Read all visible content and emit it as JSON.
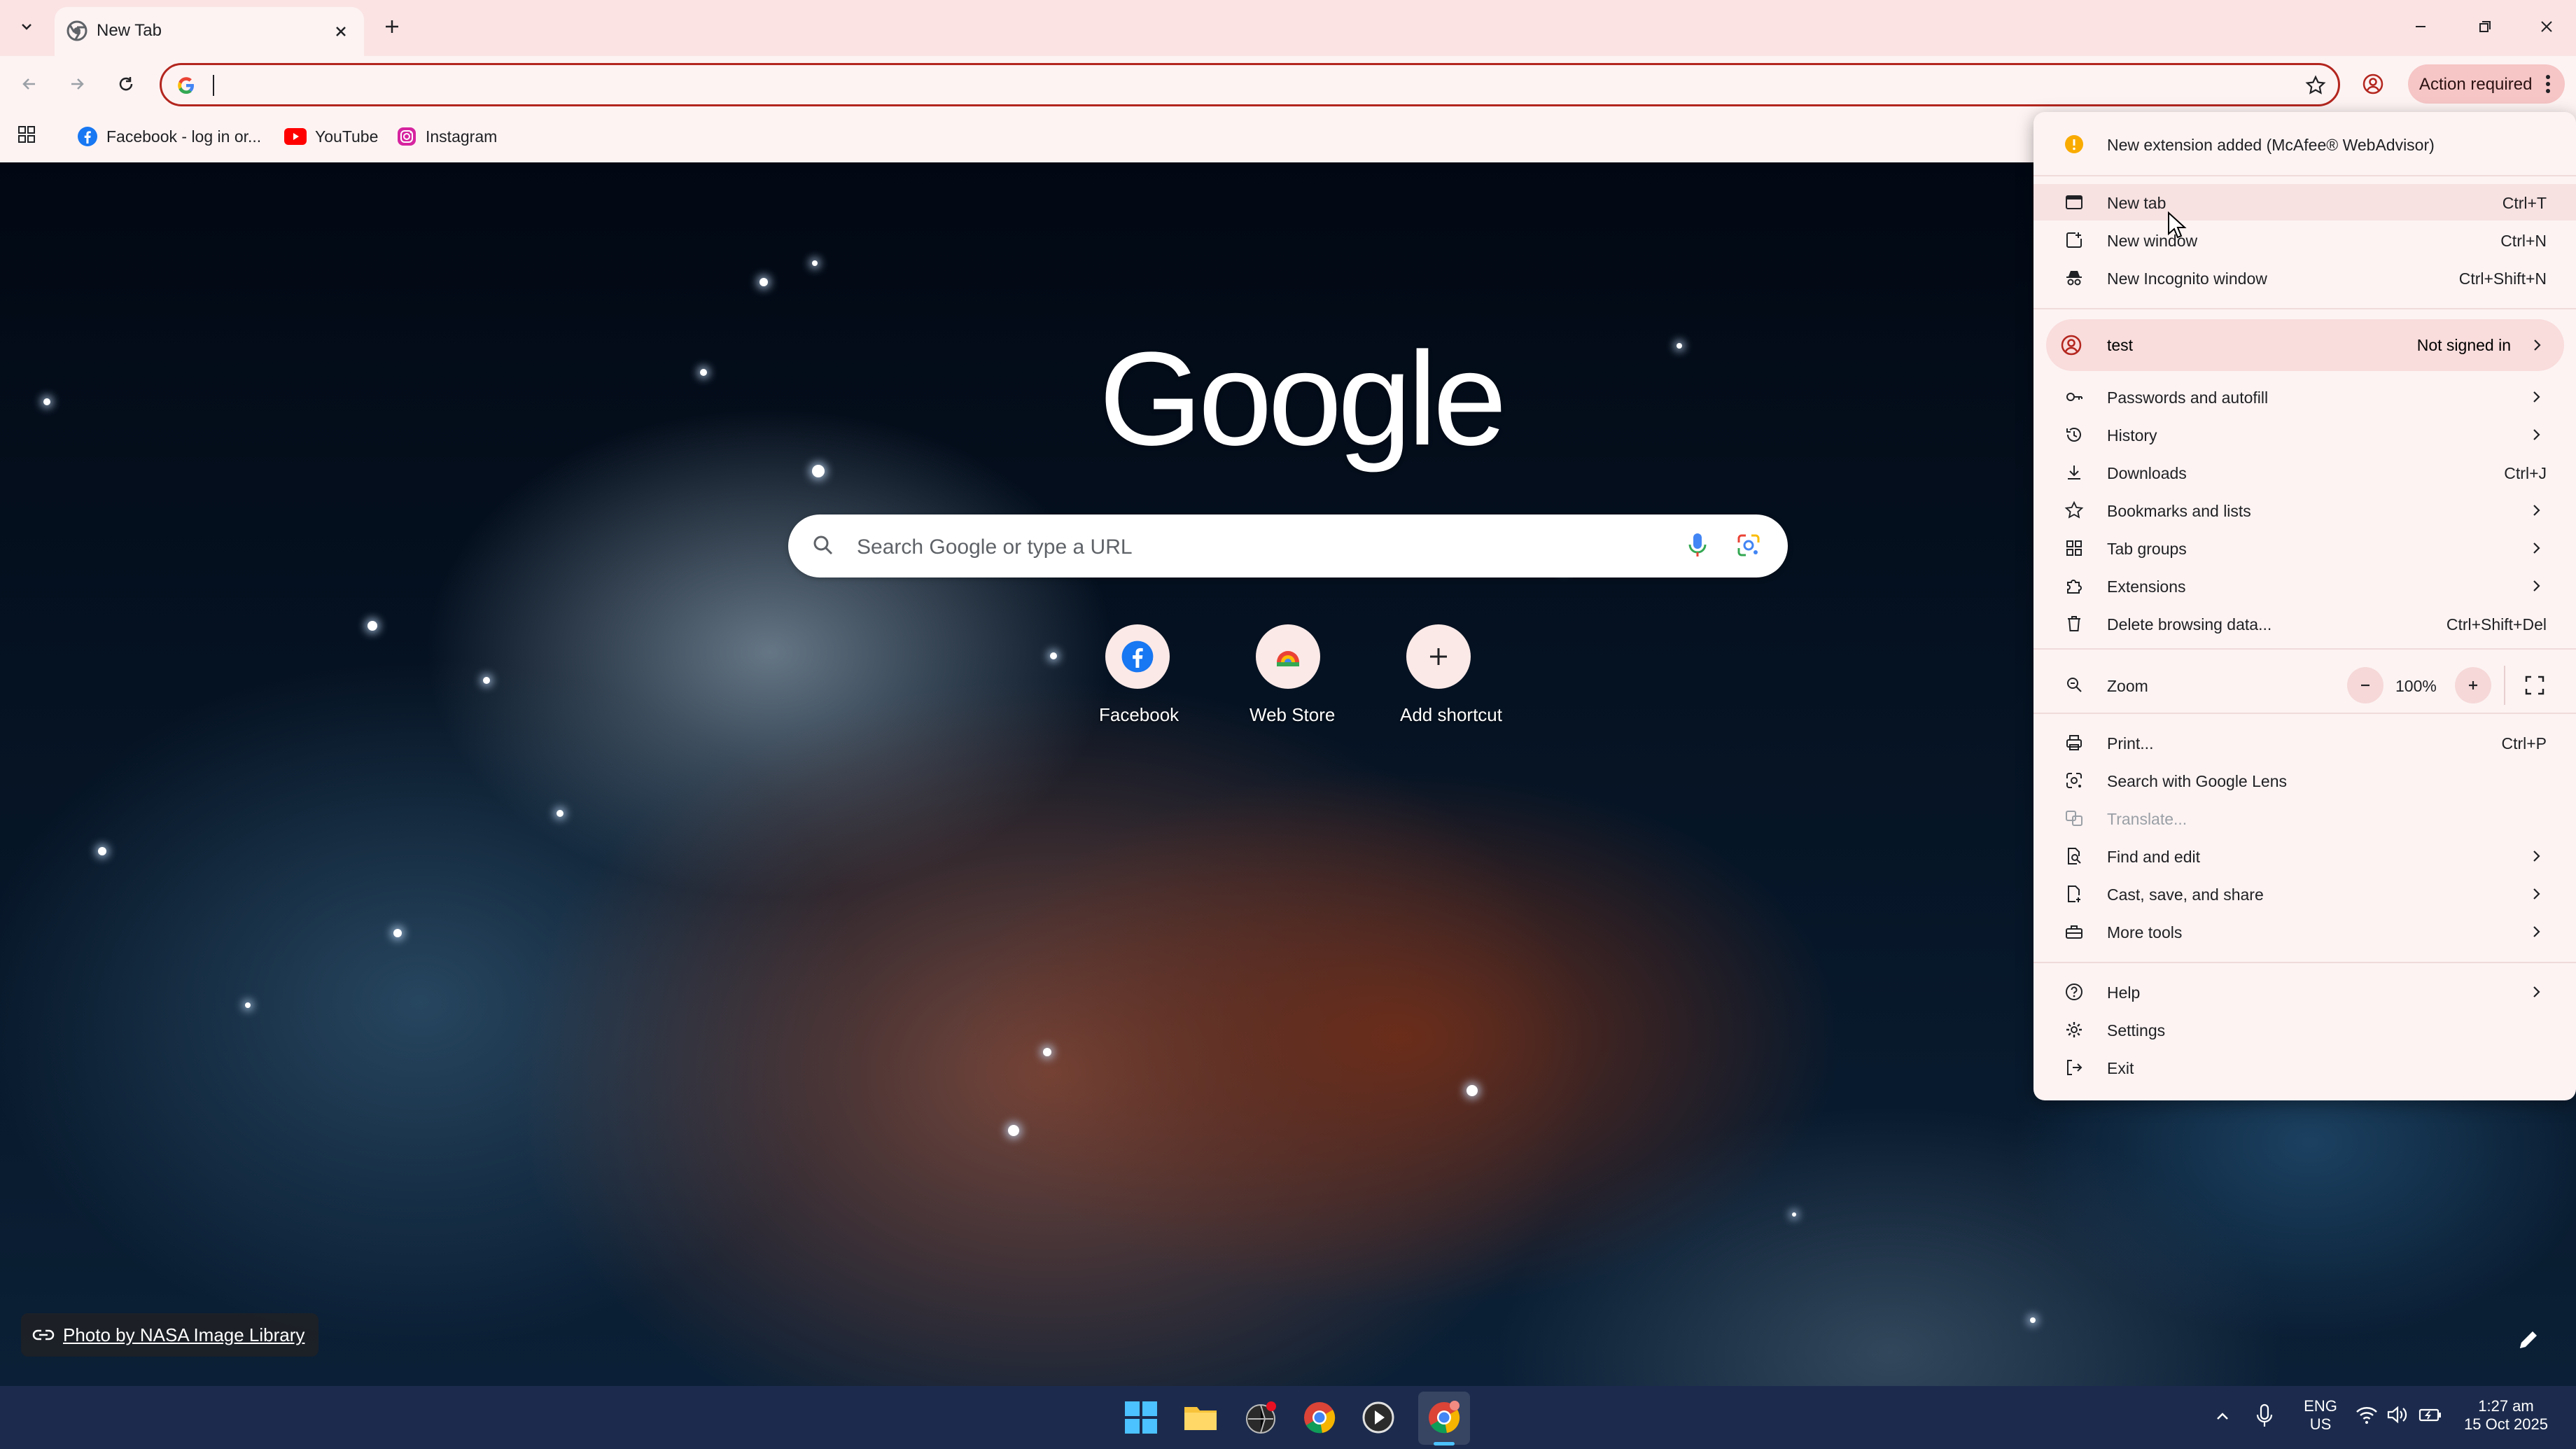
{
  "browser": {
    "tab_title": "New Tab",
    "omnibox_value": "",
    "action_label": "Action required"
  },
  "bookmarks": [
    {
      "label": "Facebook - log in or..."
    },
    {
      "label": "YouTube"
    },
    {
      "label": "Instagram"
    }
  ],
  "ntp": {
    "logo": "Google",
    "search_placeholder": "Search Google or type a URL",
    "shortcuts": [
      {
        "label": "Facebook"
      },
      {
        "label": "Web Store"
      },
      {
        "label": "Add shortcut"
      }
    ],
    "photo_credit": "Photo by NASA Image Library"
  },
  "menu": {
    "notice": "New extension added (McAfee® WebAdvisor)",
    "new_tab": {
      "label": "New tab",
      "shortcut": "Ctrl+T"
    },
    "new_window": {
      "label": "New window",
      "shortcut": "Ctrl+N"
    },
    "new_incognito": {
      "label": "New Incognito window",
      "shortcut": "Ctrl+Shift+N"
    },
    "profile": {
      "name": "test",
      "status": "Not signed in"
    },
    "passwords": {
      "label": "Passwords and autofill"
    },
    "history": {
      "label": "History"
    },
    "downloads": {
      "label": "Downloads",
      "shortcut": "Ctrl+J"
    },
    "bookmarks": {
      "label": "Bookmarks and lists"
    },
    "tab_groups": {
      "label": "Tab groups"
    },
    "extensions": {
      "label": "Extensions"
    },
    "delete_data": {
      "label": "Delete browsing data...",
      "shortcut": "Ctrl+Shift+Del"
    },
    "zoom": {
      "label": "Zoom",
      "value": "100%"
    },
    "print": {
      "label": "Print...",
      "shortcut": "Ctrl+P"
    },
    "lens": {
      "label": "Search with Google Lens"
    },
    "translate": {
      "label": "Translate..."
    },
    "find_edit": {
      "label": "Find and edit"
    },
    "cast": {
      "label": "Cast, save, and share"
    },
    "more_tools": {
      "label": "More tools"
    },
    "help": {
      "label": "Help"
    },
    "settings": {
      "label": "Settings"
    },
    "exit": {
      "label": "Exit"
    }
  },
  "taskbar": {
    "lang_top": "ENG",
    "lang_bottom": "US",
    "time": "1:27 am",
    "date": "15 Oct 2025"
  },
  "colors": {
    "omnibox_border": "#b3261e",
    "tabstrip": "#fbe3e3",
    "taskbar": "#1c2b4d"
  }
}
